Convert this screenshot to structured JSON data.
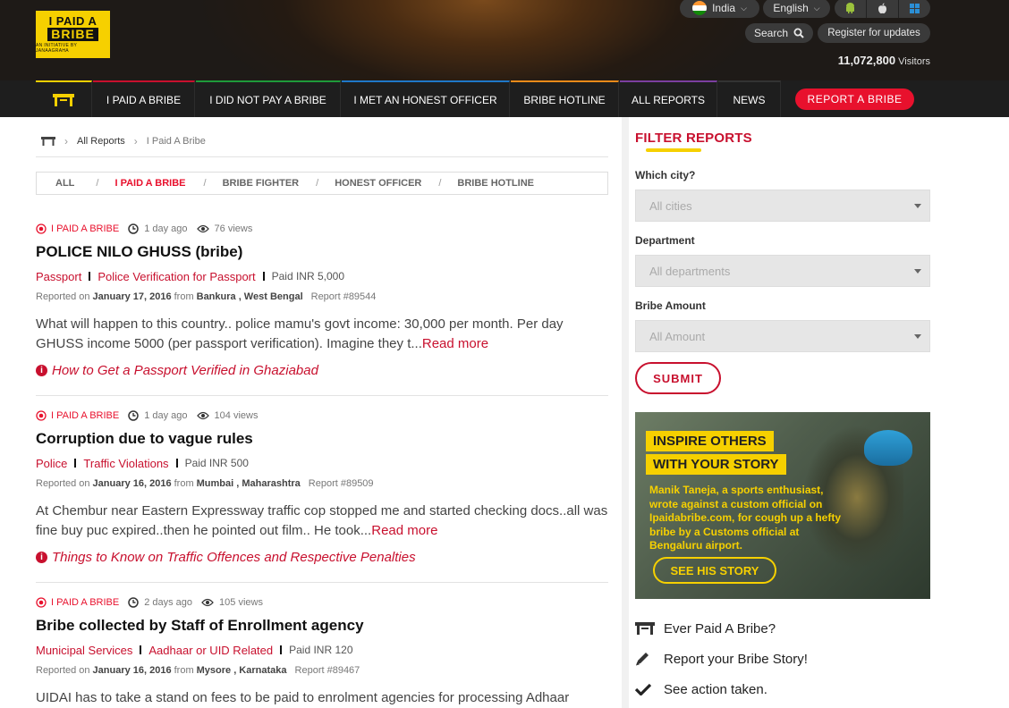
{
  "header": {
    "logo": {
      "line1": "I PAID A",
      "line2": "BRIBE",
      "tagline": "AN INITIATIVE BY JANAAGRAHA"
    },
    "country": "India",
    "language": "English",
    "search_label": "Search",
    "register_label": "Register for updates",
    "visitors_count": "11,072,800",
    "visitors_label": "Visitors",
    "apps": [
      "android-icon",
      "apple-icon",
      "windows-icon"
    ]
  },
  "nav": {
    "items": [
      "I PAID A BRIBE",
      "I DID NOT PAY A BRIBE",
      "I MET AN HONEST OFFICER",
      "BRIBE HOTLINE",
      "ALL REPORTS",
      "NEWS"
    ],
    "report_button": "REPORT A BRIBE"
  },
  "breadcrumb": {
    "items": [
      "All Reports",
      "I Paid A Bribe"
    ]
  },
  "filter_tabs": {
    "items": [
      "ALL",
      "I PAID A BRIBE",
      "BRIBE FIGHTER",
      "HONEST OFFICER",
      "BRIBE HOTLINE"
    ],
    "active": "I PAID A BRIBE"
  },
  "reports": [
    {
      "category": "I PAID A BRIBE",
      "time": "1 day ago",
      "views": "76 views",
      "title": "POLICE NILO GHUSS (bribe)",
      "dept": "Passport",
      "transaction": "Police Verification for Passport",
      "paid": "Paid INR 5,000",
      "reported_on_label": "Reported on",
      "date": "January 17, 2016",
      "from_label": "from",
      "location": "Bankura , West Bengal",
      "report_id": "Report #89544",
      "text": "What will happen to this country.. police mamu's govt income: 30,000 per month. Per day GHUSS income 5000 (per passport verification). Imagine they t...",
      "read_more": "Read more",
      "guide": "How to Get a Passport Verified in Ghaziabad"
    },
    {
      "category": "I PAID A BRIBE",
      "time": "1 day ago",
      "views": "104 views",
      "title": "Corruption due to vague rules",
      "dept": "Police",
      "transaction": "Traffic Violations",
      "paid": "Paid INR 500",
      "reported_on_label": "Reported on",
      "date": "January 16, 2016",
      "from_label": "from",
      "location": "Mumbai , Maharashtra",
      "report_id": "Report #89509",
      "text": "At Chembur near Eastern Expressway traffic cop stopped me and started checking docs..all was fine buy puc expired..then he pointed out film.. He took...",
      "read_more": "Read more",
      "guide": "Things to Know on Traffic Offences and Respective Penalties"
    },
    {
      "category": "I PAID A BRIBE",
      "time": "2 days ago",
      "views": "105 views",
      "title": "Bribe collected by Staff of Enrollment agency",
      "dept": "Municipal Services",
      "transaction": "Aadhaar or UID Related",
      "paid": "Paid INR 120",
      "reported_on_label": "Reported on",
      "date": "January 16, 2016",
      "from_label": "from",
      "location": "Mysore , Karnataka",
      "report_id": "Report #89467",
      "text": "UIDAI has to take a stand on fees to be paid to enrolment agencies for processing Adhaar"
    }
  ],
  "sidebar": {
    "filter_title": "FILTER REPORTS",
    "city_label": "Which city?",
    "city_value": "All cities",
    "dept_label": "Department",
    "dept_value": "All departments",
    "amount_label": "Bribe Amount",
    "amount_value": "All Amount",
    "submit": "SUBMIT",
    "promo": {
      "line1": "INSPIRE OTHERS",
      "line2": "WITH YOUR STORY",
      "desc": "Manik Taneja, a sports enthusiast, wrote against a custom official on Ipaidabribe.com, for cough up a hefty bribe by a Customs official at Bengaluru airport.",
      "cta": "SEE HIS STORY"
    },
    "ctas": [
      "Ever Paid A Bribe?",
      "Report your Bribe Story!",
      "See action taken."
    ]
  },
  "colors": {
    "accent": "#c8102e",
    "brand_yellow": "#f6d000",
    "nav_bg": "#1e1e1e"
  }
}
